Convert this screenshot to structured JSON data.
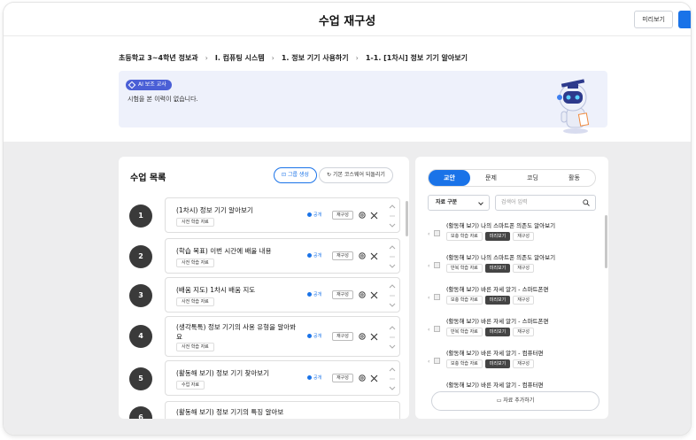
{
  "header": {
    "title": "수업 재구성",
    "preview_label": "미리보기"
  },
  "breadcrumb": [
    "초등학교 3~4학년 정보과",
    "I. 컴퓨팅 시스템",
    "1. 정보 기기 사용하기",
    "1-1. [1차시] 정보 기기 알아보기"
  ],
  "ai": {
    "badge": "AI 보조 교사",
    "message": "시험을 본 이력이 없습니다."
  },
  "lessons_panel": {
    "title": "수업 목록",
    "group_button": "그룹 생성",
    "reset_button": "기본 코스웨어 되돌리기",
    "public_label": "공개",
    "reconstruct_label": "재구성",
    "lessons": [
      {
        "num": "1",
        "title": "(1차시) 정보 기기 알아보기",
        "tag": "사전 학습 자료"
      },
      {
        "num": "2",
        "title": "(학습 목표) 이번 시간에 배울 내용",
        "tag": "사전 학습 자료"
      },
      {
        "num": "3",
        "title": "(배움 지도) 1차시 배움 지도",
        "tag": "사전 학습 자료"
      },
      {
        "num": "4",
        "title": "(생각톡톡) 정보 기기의 사용 유형을 알아봐요",
        "tag": "사전 학습 자료"
      },
      {
        "num": "5",
        "title": "(활동해 보기) 정보 기기 찾아보기",
        "tag": "수업 자료"
      },
      {
        "num": "6",
        "title": "(활동해 보기) 정보 기기의 특징 알아보",
        "tag": ""
      }
    ]
  },
  "materials_panel": {
    "tabs": [
      "교안",
      "문제",
      "코딩",
      "활동"
    ],
    "active_tab": "교안",
    "filter_label": "자료 구분",
    "search_placeholder": "검색어 입력",
    "preview_label": "미리보기",
    "reconstruct_label": "재구성",
    "add_button": "자료 추가하기",
    "items": [
      {
        "title": "(활동해 보기) 나의 스마트폰 의존도 알아보기",
        "tag": "보충 학습 자료"
      },
      {
        "title": "(활동해 보기) 나의 스마트폰 의존도 알아보기",
        "tag": "반복 학습 자료"
      },
      {
        "title": "(활동해 보기) 바른 자세 알기 - 스마트폰편",
        "tag": "보충 학습 자료"
      },
      {
        "title": "(활동해 보기) 바른 자세 알기 - 스마트폰편",
        "tag": "반복 학습 자료"
      },
      {
        "title": "(활동해 보기) 바른 자세 알기 - 컴퓨터편",
        "tag": "보충 학습 자료"
      },
      {
        "title": "(활동해 보기) 바른 자세 알기 - 컴퓨터편",
        "tag": ""
      }
    ]
  },
  "colors": {
    "accent": "#1a73e8",
    "ai_badge": "#4a5fd6",
    "ai_bg": "#eef1fb"
  }
}
